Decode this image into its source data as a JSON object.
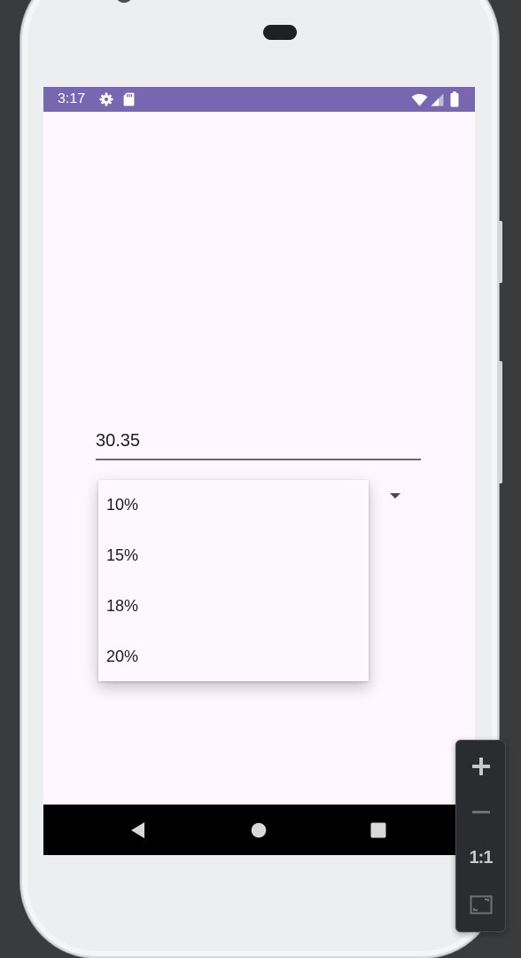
{
  "status_bar": {
    "time": "3:17",
    "left_icons": [
      "settings-icon",
      "sd-card-icon"
    ],
    "right_icons": [
      "wifi-icon",
      "signal-icon",
      "battery-icon"
    ],
    "color": "#7767b0"
  },
  "tip_form": {
    "amount_value": "30.35",
    "tip_menu": {
      "options": [
        "10%",
        "15%",
        "18%",
        "20%"
      ]
    }
  },
  "navigation": {
    "buttons": [
      "back-icon",
      "home-icon",
      "overview-icon"
    ]
  },
  "emulator_zoom": {
    "ratio_label": "1:1",
    "buttons": [
      "zoom-in-icon",
      "zoom-out-icon",
      "one-to-one",
      "fit-screen-icon"
    ]
  },
  "colors": {
    "screen_background": "#fef7ff",
    "phone_body": "#eceef0",
    "app_accent": "#7767b0",
    "text": "#1c1b1f"
  }
}
